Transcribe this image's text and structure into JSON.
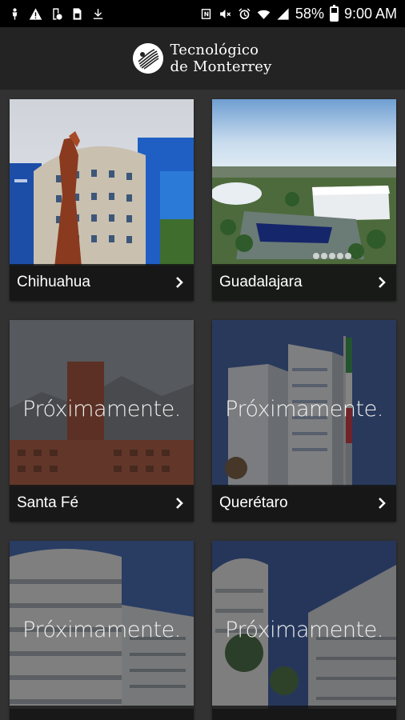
{
  "status_bar": {
    "battery_percent": "58%",
    "time": "9:00 AM",
    "left_icons": [
      "person-icon",
      "warning-icon",
      "phone-check-icon",
      "sim-icon",
      "download-icon"
    ],
    "right_icons": [
      "nfc-icon",
      "mute-icon",
      "alarm-icon",
      "wifi-icon",
      "signal-icon",
      "battery-icon"
    ]
  },
  "header": {
    "logo_line1": "Tecnológico",
    "logo_line2": "de Monterrey"
  },
  "campuses": [
    {
      "name": "Chihuahua",
      "coming_soon": ""
    },
    {
      "name": "Guadalajara",
      "coming_soon": ""
    },
    {
      "name": "Santa Fé",
      "coming_soon": "Próximamente."
    },
    {
      "name": "Querétaro",
      "coming_soon": "Próximamente."
    },
    {
      "name": "",
      "coming_soon": "Próximamente."
    },
    {
      "name": "",
      "coming_soon": "Próximamente."
    }
  ],
  "colors": {
    "background": "#323232",
    "header": "#232323",
    "status_bar": "#000000",
    "label_bar": "#141414"
  }
}
